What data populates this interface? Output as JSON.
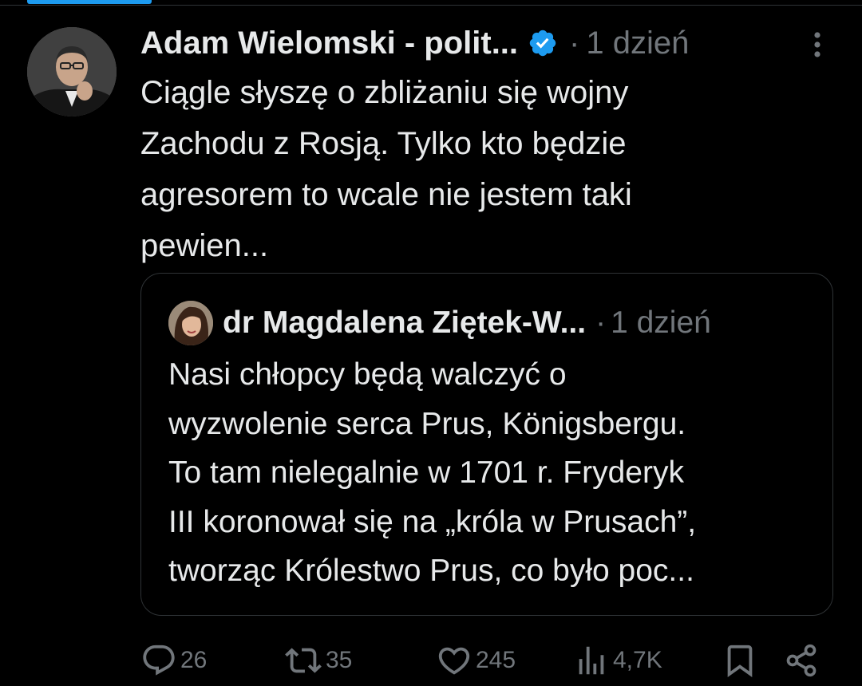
{
  "tweet": {
    "author_name": "Adam Wielomski - polit...",
    "verified_icon": "verified-badge-icon",
    "separator": "·",
    "timestamp": "1 dzień",
    "text": "Ciągle słyszę o zbliżaniu się wojny\nZachodu z Rosją. Tylko kto będzie\nagresorem to wcale nie jestem taki\npewien...",
    "more_icon": "more-vertical-icon"
  },
  "quote": {
    "author_name": "dr Magdalena Ziętek-W...",
    "separator": "·",
    "timestamp": "1 dzień",
    "text": "Nasi chłopcy będą walczyć o\nwyzwolenie serca Prus, Königsbergu.\nTo tam nielegalnie w 1701 r. Fryderyk\nIII koronował się na „króla w Prusach”,\ntworząc Królestwo Prus, co było poc..."
  },
  "actions": {
    "reply": {
      "icon": "reply-icon",
      "count": "26"
    },
    "retweet": {
      "icon": "retweet-icon",
      "count": "35"
    },
    "like": {
      "icon": "heart-icon",
      "count": "245"
    },
    "views": {
      "icon": "views-icon",
      "count": "4,7K"
    },
    "bookmark": {
      "icon": "bookmark-icon"
    },
    "share": {
      "icon": "share-icon"
    }
  },
  "colors": {
    "background": "#000000",
    "text": "#e7e9ea",
    "secondary": "#71767b",
    "accent": "#1d9bf0",
    "border": "#2f3336"
  }
}
